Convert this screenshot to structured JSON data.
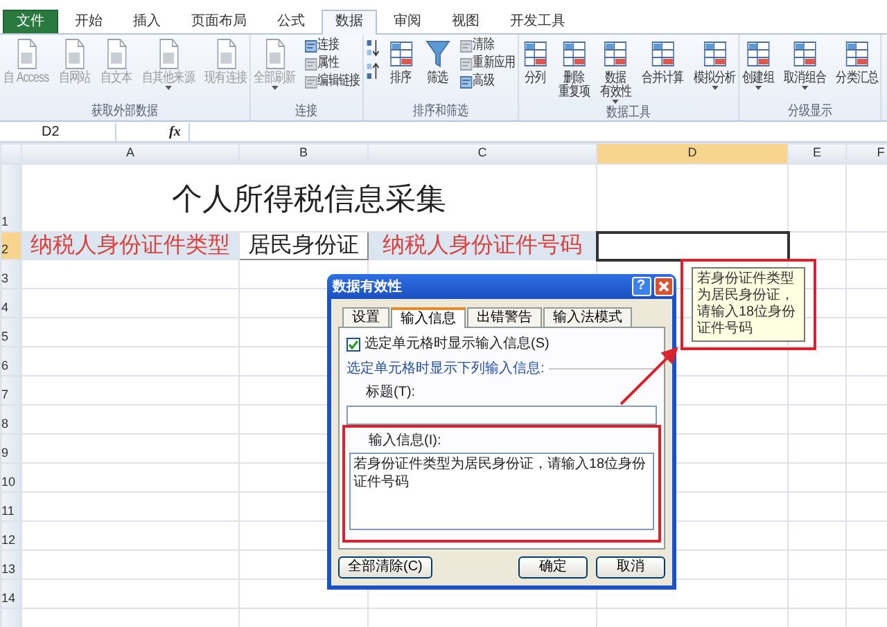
{
  "ribbon_tabs": [
    {
      "label": "文件",
      "kind": "file",
      "selected": false
    },
    {
      "label": "开始",
      "kind": "tab",
      "selected": false
    },
    {
      "label": "插入",
      "kind": "tab",
      "selected": false
    },
    {
      "label": "页面布局",
      "kind": "tab",
      "selected": false
    },
    {
      "label": "公式",
      "kind": "tab",
      "selected": false
    },
    {
      "label": "数据",
      "kind": "tab",
      "selected": true
    },
    {
      "label": "审阅",
      "kind": "tab",
      "selected": false
    },
    {
      "label": "视图",
      "kind": "tab",
      "selected": false
    },
    {
      "label": "开发工具",
      "kind": "tab",
      "selected": false
    }
  ],
  "ribbon_groups": [
    {
      "label": "获取外部数据",
      "commands": [
        {
          "kind": "large",
          "lines": [
            "自 Access"
          ],
          "disabled": true,
          "dropdown": false
        },
        {
          "kind": "large",
          "lines": [
            "自网站"
          ],
          "disabled": true,
          "dropdown": false
        },
        {
          "kind": "large",
          "lines": [
            "自文本"
          ],
          "disabled": true,
          "dropdown": false
        },
        {
          "kind": "large",
          "lines": [
            "自其他来源"
          ],
          "disabled": true,
          "dropdown": true
        },
        {
          "kind": "large",
          "lines": [
            "现有连接"
          ],
          "disabled": true,
          "dropdown": false
        }
      ]
    },
    {
      "label": "连接",
      "commands": [
        {
          "kind": "large",
          "lines": [
            "全部刷新"
          ],
          "disabled": true,
          "dropdown": true
        },
        {
          "kind": "stack",
          "items": [
            {
              "label": "连接",
              "disabled": false
            },
            {
              "label": "属性",
              "disabled": true
            },
            {
              "label": "编辑链接",
              "disabled": true
            }
          ]
        }
      ]
    },
    {
      "label": "排序和筛选",
      "commands": [
        {
          "kind": "sort_pair"
        },
        {
          "kind": "large",
          "lines": [
            "排序"
          ],
          "disabled": false,
          "dropdown": false
        },
        {
          "kind": "large",
          "lines": [
            "筛选"
          ],
          "disabled": false,
          "dropdown": false
        },
        {
          "kind": "stack",
          "items": [
            {
              "label": "清除",
              "disabled": true
            },
            {
              "label": "重新应用",
              "disabled": true
            },
            {
              "label": "高级",
              "disabled": false
            }
          ]
        }
      ]
    },
    {
      "label": "数据工具",
      "commands": [
        {
          "kind": "large",
          "lines": [
            "分列"
          ],
          "disabled": false,
          "dropdown": false
        },
        {
          "kind": "large",
          "lines": [
            "删除",
            "重复项"
          ],
          "disabled": false,
          "dropdown": false
        },
        {
          "kind": "large",
          "lines": [
            "数据",
            "有效性"
          ],
          "disabled": false,
          "dropdown": true
        },
        {
          "kind": "large",
          "lines": [
            "合并计算"
          ],
          "disabled": false,
          "dropdown": false
        },
        {
          "kind": "large",
          "lines": [
            "模拟分析"
          ],
          "disabled": false,
          "dropdown": true
        }
      ]
    },
    {
      "label": "分级显示",
      "commands": [
        {
          "kind": "large",
          "lines": [
            "创建组"
          ],
          "disabled": false,
          "dropdown": true
        },
        {
          "kind": "large",
          "lines": [
            "取消组合"
          ],
          "disabled": false,
          "dropdown": true
        },
        {
          "kind": "large",
          "lines": [
            "分类汇总"
          ],
          "disabled": false,
          "dropdown": false
        }
      ]
    }
  ],
  "formula_bar": {
    "name_box": "D2",
    "function_label": "fx"
  },
  "sheet": {
    "columns": [
      {
        "label": "A",
        "selected": false
      },
      {
        "label": "B",
        "selected": false
      },
      {
        "label": "C",
        "selected": false
      },
      {
        "label": "D",
        "selected": true
      },
      {
        "label": "E",
        "selected": false
      },
      {
        "label": "F",
        "selected": false
      }
    ],
    "rows": [
      {
        "label": "1",
        "selected": false
      },
      {
        "label": "2",
        "selected": true
      },
      {
        "label": "3",
        "selected": false
      },
      {
        "label": "4",
        "selected": false
      },
      {
        "label": "5",
        "selected": false
      },
      {
        "label": "6",
        "selected": false
      },
      {
        "label": "7",
        "selected": false
      },
      {
        "label": "8",
        "selected": false
      },
      {
        "label": "9",
        "selected": false
      },
      {
        "label": "10",
        "selected": false
      },
      {
        "label": "11",
        "selected": false
      },
      {
        "label": "12",
        "selected": false
      },
      {
        "label": "13",
        "selected": false
      },
      {
        "label": "14",
        "selected": false
      }
    ],
    "title": "个人所得税信息采集",
    "row_2": [
      {
        "kind": "label",
        "text": "纳税人身份证件类型"
      },
      {
        "kind": "value",
        "text": "居民身份证"
      },
      {
        "kind": "label",
        "text": "纳税人身份证件号码"
      },
      {
        "kind": "input",
        "selected": true
      }
    ]
  },
  "dialog": {
    "title": "数据有效性",
    "help_glyph": "?",
    "tabs": [
      {
        "label": "设置",
        "selected": false
      },
      {
        "label": "输入信息",
        "selected": true
      },
      {
        "label": "出错警告",
        "selected": false
      },
      {
        "label": "输入法模式",
        "selected": false
      }
    ],
    "show_input_checkbox": {
      "label": "选定单元格时显示输入信息(S)",
      "checked": true
    },
    "section_label": "选定单元格时显示下列输入信息:",
    "title_field": {
      "label": "标题(T):"
    },
    "message_field": {
      "label": "输入信息(I):",
      "value": "若身份证件类型为居民身份证，请输入18位身份证件号码"
    },
    "buttons": [
      {
        "label": "全部清除(C)",
        "kind": "left"
      },
      {
        "label": "确定",
        "kind": "right"
      },
      {
        "label": "取消",
        "kind": "right"
      }
    ]
  },
  "tooltip": {
    "text": "若身份证件类型为居民身份证，请输入18位身份证件号码"
  }
}
